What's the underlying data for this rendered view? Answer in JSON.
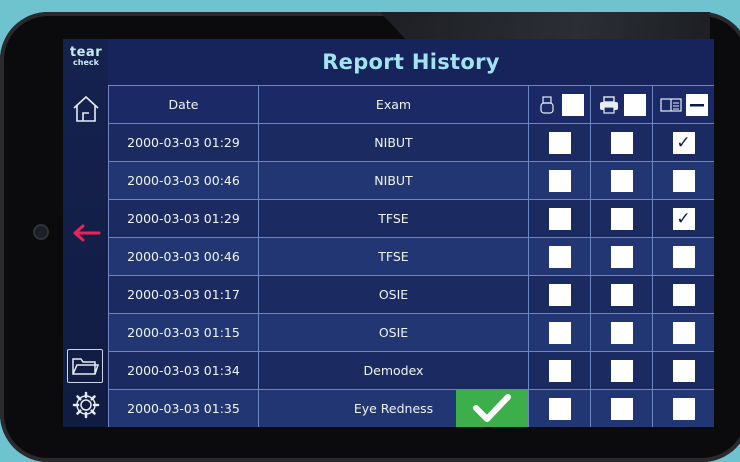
{
  "app": {
    "logo_line1": "tear",
    "logo_line2": "check"
  },
  "header": {
    "title": "Report History"
  },
  "table": {
    "columns": [
      "Date",
      "Exam"
    ],
    "header_select_all": {
      "usb": false,
      "print": false,
      "view": "indeterminate"
    },
    "rows": [
      {
        "date": "2000-03-03 01:29",
        "exam": "NIBUT",
        "usb": false,
        "print": false,
        "view": true
      },
      {
        "date": "2000-03-03 00:46",
        "exam": "NIBUT",
        "usb": false,
        "print": false,
        "view": false
      },
      {
        "date": "2000-03-03 01:29",
        "exam": "TFSE",
        "usb": false,
        "print": false,
        "view": true
      },
      {
        "date": "2000-03-03 00:46",
        "exam": "TFSE",
        "usb": false,
        "print": false,
        "view": false
      },
      {
        "date": "2000-03-03 01:17",
        "exam": "OSIE",
        "usb": false,
        "print": false,
        "view": false
      },
      {
        "date": "2000-03-03 01:15",
        "exam": "OSIE",
        "usb": false,
        "print": false,
        "view": false
      },
      {
        "date": "2000-03-03 01:34",
        "exam": "Demodex",
        "usb": false,
        "print": false,
        "view": false
      },
      {
        "date": "2000-03-03 01:35",
        "exam": "Eye Redness",
        "usb": false,
        "print": false,
        "view": false
      }
    ]
  },
  "icons": {
    "home": "home-icon",
    "back": "arrow-left-icon",
    "folder": "folder-icon",
    "settings": "gear-icon",
    "usb": "usb-icon",
    "print": "printer-icon",
    "view": "view-icon",
    "confirm": "checkmark-icon"
  },
  "colors": {
    "accent_title": "#9fe4ee",
    "back_arrow": "#e8245a",
    "confirm": "#3cae4a",
    "background": "#6fc3cf",
    "screen": "#16245b"
  }
}
